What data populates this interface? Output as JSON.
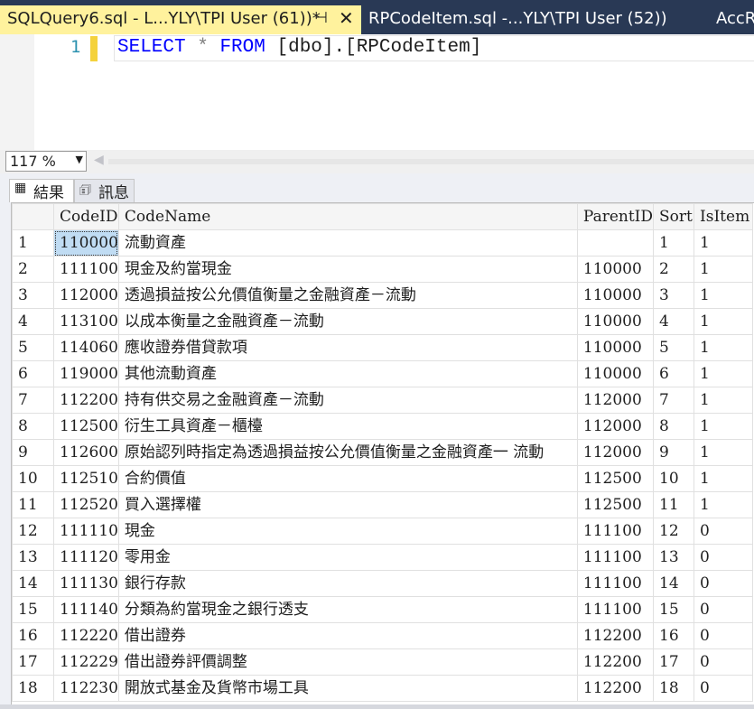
{
  "tabs": [
    {
      "title": "SQLQuery6.sql - L...YLY\\TPI User (61))*",
      "active": true
    },
    {
      "title": "RPCodeItem.sql -...YLY\\TPI User (52))",
      "active": false
    },
    {
      "title": "AccR",
      "active": false
    }
  ],
  "tab_icons": {
    "pin": "pin-icon",
    "close": "close-icon"
  },
  "editor": {
    "line_number": "1",
    "tokens": {
      "select": "SELECT",
      "star": "*",
      "from": "FROM",
      "table": "[dbo].[RPCodeItem]"
    }
  },
  "zoom": {
    "value": "117 %"
  },
  "result_tabs": {
    "results": {
      "label": "結果",
      "icon": "grid-icon"
    },
    "messages": {
      "label": "訊息",
      "icon": "messages-icon"
    }
  },
  "grid": {
    "columns": [
      "",
      "CodeID",
      "CodeName",
      "ParentID",
      "Sort",
      "IsItem"
    ],
    "rows": [
      [
        "1",
        "110000",
        "流動資產",
        "",
        "1",
        "1"
      ],
      [
        "2",
        "111100",
        "現金及約當現金",
        "110000",
        "2",
        "1"
      ],
      [
        "3",
        "112000",
        "透過損益按公允價值衡量之金融資產－流動",
        "110000",
        "3",
        "1"
      ],
      [
        "4",
        "113100",
        "以成本衡量之金融資產－流動",
        "110000",
        "4",
        "1"
      ],
      [
        "5",
        "114060",
        "應收證券借貸款項",
        "110000",
        "5",
        "1"
      ],
      [
        "6",
        "119000",
        "其他流動資產",
        "110000",
        "6",
        "1"
      ],
      [
        "7",
        "112200",
        "持有供交易之金融資產－流動",
        "112000",
        "7",
        "1"
      ],
      [
        "8",
        "112500",
        "衍生工具資產－櫃檯",
        "112000",
        "8",
        "1"
      ],
      [
        "9",
        "112600",
        "原始認列時指定為透過損益按公允價值衡量之金融資產一 流動",
        "112000",
        "9",
        "1"
      ],
      [
        "10",
        "112510",
        "合約價值",
        "112500",
        "10",
        "1"
      ],
      [
        "11",
        "112520",
        "買入選擇權",
        "112500",
        "11",
        "1"
      ],
      [
        "12",
        "111110",
        "現金",
        "111100",
        "12",
        "0"
      ],
      [
        "13",
        "111120",
        "零用金",
        "111100",
        "13",
        "0"
      ],
      [
        "14",
        "111130",
        "銀行存款",
        "111100",
        "14",
        "0"
      ],
      [
        "15",
        "111140",
        "分類為約當現金之銀行透支",
        "111100",
        "15",
        "0"
      ],
      [
        "16",
        "112220",
        "借出證券",
        "112200",
        "16",
        "0"
      ],
      [
        "17",
        "112229",
        "借出證券評價調整",
        "112200",
        "17",
        "0"
      ],
      [
        "18",
        "112230",
        "開放式基金及貨幣市場工具",
        "112200",
        "18",
        "0"
      ]
    ],
    "selected_cell": {
      "row": 0,
      "col": 1
    }
  },
  "colors": {
    "tab_strip": "#293955",
    "active_tab": "#fff29d",
    "keyword": "#0000ff",
    "line_number": "#2b91af",
    "selection": "#c0dcf3"
  }
}
